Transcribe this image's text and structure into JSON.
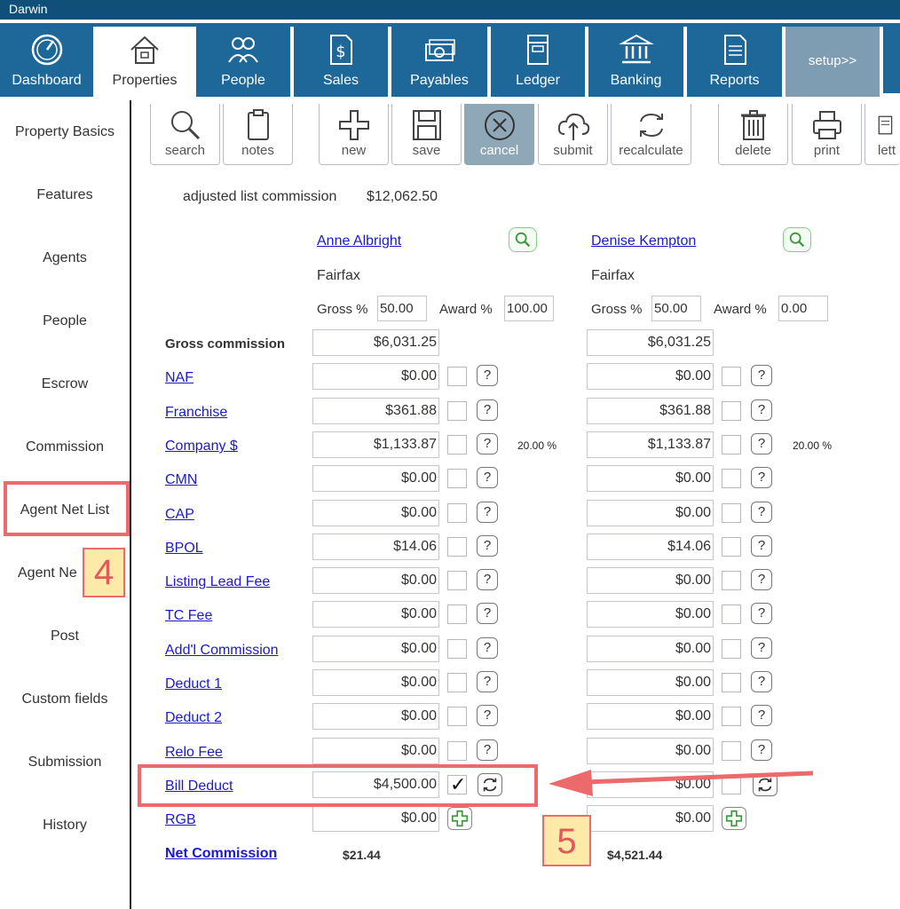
{
  "app": {
    "title": "Darwin"
  },
  "nav": {
    "tabs": [
      {
        "label": "Dashboard",
        "icon": "dashboard-gauge-icon"
      },
      {
        "label": "Properties",
        "icon": "house-icon",
        "active": true
      },
      {
        "label": "People",
        "icon": "people-icon"
      },
      {
        "label": "Sales",
        "icon": "dollar-document-icon"
      },
      {
        "label": "Payables",
        "icon": "money-stack-icon"
      },
      {
        "label": "Ledger",
        "icon": "ledger-book-icon"
      },
      {
        "label": "Banking",
        "icon": "bank-icon"
      },
      {
        "label": "Reports",
        "icon": "report-icon"
      }
    ],
    "setup_label": "setup>>"
  },
  "sidebar": {
    "items": [
      "Property Basics",
      "Features",
      "Agents",
      "People",
      "Escrow",
      "Commission",
      "Agent Net List",
      "Agent Ne",
      "Post",
      "Custom fields",
      "Submission",
      "History"
    ]
  },
  "annotations": {
    "tag4": "4",
    "tag5": "5"
  },
  "toolbar": {
    "buttons": [
      {
        "label": "search",
        "icon": "magnifier-icon"
      },
      {
        "label": "notes",
        "icon": "clipboard-icon"
      },
      {
        "label": "new",
        "icon": "plus-icon"
      },
      {
        "label": "save",
        "icon": "floppy-disk-icon"
      },
      {
        "label": "cancel",
        "icon": "cancel-circle-icon",
        "active": true
      },
      {
        "label": "submit",
        "icon": "cloud-upload-icon"
      },
      {
        "label": "recalculate",
        "icon": "refresh-icon"
      },
      {
        "label": "delete",
        "icon": "trash-icon"
      },
      {
        "label": "print",
        "icon": "printer-icon"
      },
      {
        "label": "lett",
        "icon": "letter-icon"
      }
    ]
  },
  "summary": {
    "label": "adjusted list commission",
    "value": "$12,062.50"
  },
  "agents": [
    {
      "name": "Anne Albright",
      "office": "Fairfax",
      "gross_label": "Gross %",
      "gross_pct": "50.00",
      "award_label": "Award %",
      "award_pct": "100.00"
    },
    {
      "name": "Denise Kempton",
      "office": "Fairfax",
      "gross_label": "Gross %",
      "gross_pct": "50.00",
      "award_label": "Award %",
      "award_pct": "0.00"
    }
  ],
  "rows": [
    {
      "label": "Gross commission",
      "a": "$6,031.25",
      "b": "$6,031.25",
      "kind": "gross"
    },
    {
      "label": "NAF",
      "a": "$0.00",
      "b": "$0.00"
    },
    {
      "label": "Franchise",
      "a": "$361.88",
      "b": "$361.88"
    },
    {
      "label": "Company $",
      "a": "$1,133.87",
      "b": "$1,133.87",
      "pct": "20.00 %"
    },
    {
      "label": "CMN",
      "a": "$0.00",
      "b": "$0.00"
    },
    {
      "label": "CAP",
      "a": "$0.00",
      "b": "$0.00"
    },
    {
      "label": "BPOL",
      "a": "$14.06",
      "b": "$14.06"
    },
    {
      "label": "Listing Lead Fee",
      "a": "$0.00",
      "b": "$0.00"
    },
    {
      "label": "TC Fee",
      "a": "$0.00",
      "b": "$0.00"
    },
    {
      "label": "Add'l Commission",
      "a": "$0.00",
      "b": "$0.00"
    },
    {
      "label": "Deduct 1",
      "a": "$0.00",
      "b": "$0.00"
    },
    {
      "label": "Deduct 2",
      "a": "$0.00",
      "b": "$0.00"
    },
    {
      "label": "Relo Fee",
      "a": "$0.00",
      "b": "$0.00"
    },
    {
      "label": "Bill Deduct",
      "a": "$4,500.00",
      "b": "$0.00",
      "kind": "bill",
      "a_checked": true
    },
    {
      "label": "RGB",
      "a": "$0.00",
      "b": "$0.00",
      "kind": "rgb"
    }
  ],
  "net": {
    "label": "Net Commission",
    "a": "$21.44",
    "b": "$4,521.44"
  },
  "colors": {
    "nav_blue": "#1e6799",
    "title_blue": "#0f4f78",
    "highlight_red": "#ec6a6c",
    "link_blue": "#1a1acc"
  }
}
